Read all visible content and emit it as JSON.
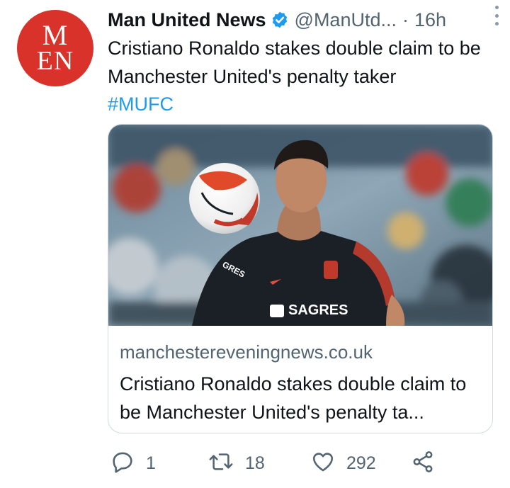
{
  "author": {
    "avatar_line1": "M",
    "avatar_line2": "EN",
    "name": "Man United News",
    "handle": "@ManUtd...",
    "separator": "·",
    "time": "16h"
  },
  "tweet": {
    "text": "Cristiano Ronaldo stakes double claim to be Manchester United's penalty taker",
    "hashtag": "#MUFC"
  },
  "card": {
    "domain": "manchestereveningnews.co.uk",
    "title": "Cristiano Ronaldo stakes double claim to be Manchester United's penalty ta...",
    "image_shirt_text": "SAGRES",
    "image_sleeve_text": "GRES"
  },
  "actions": {
    "reply_count": "1",
    "retweet_count": "18",
    "like_count": "292"
  },
  "icons": {
    "verified": "verified-badge-icon",
    "more": "more-vertical-icon",
    "reply": "reply-icon",
    "retweet": "retweet-icon",
    "like": "heart-icon",
    "share": "share-icon"
  },
  "colors": {
    "accent": "#1d9bf0",
    "avatar_bg": "#d9322b",
    "secondary_text": "#536471"
  }
}
